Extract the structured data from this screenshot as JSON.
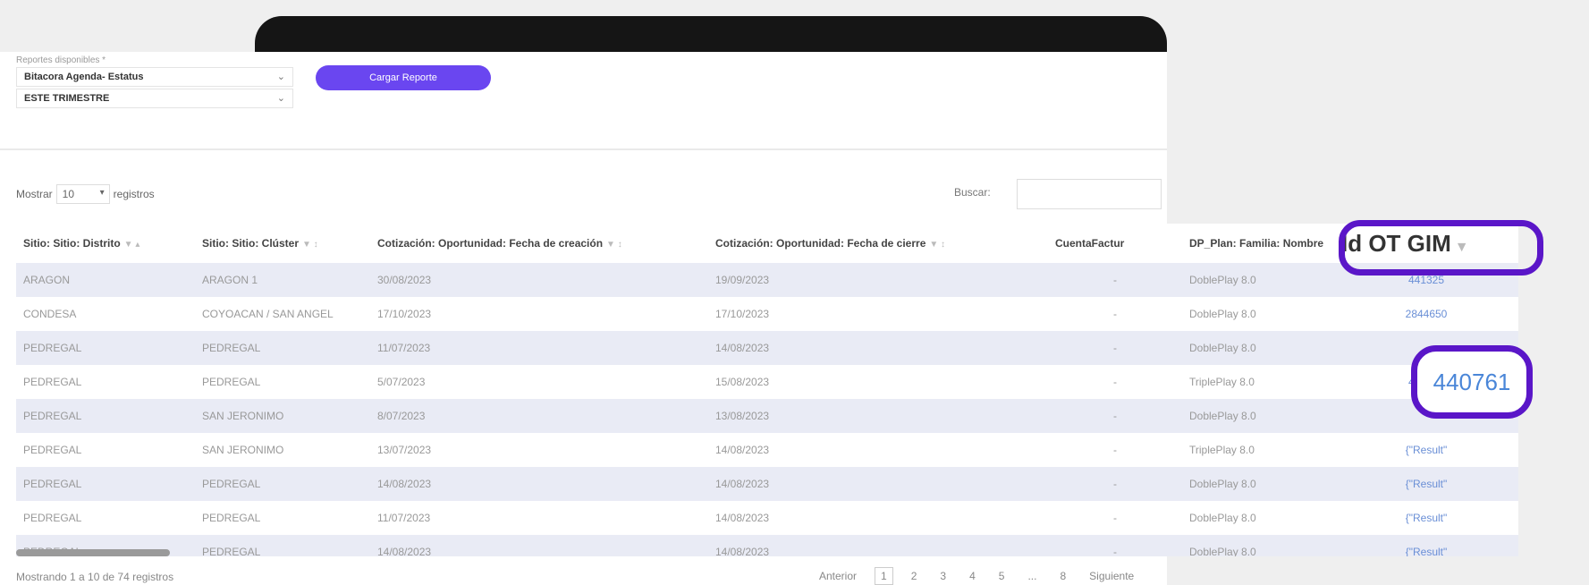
{
  "report": {
    "label": "Reportes disponibles *",
    "selected_report": "Bitacora Agenda- Estatus",
    "selected_period": "ESTE TRIMESTRE",
    "load_button": "Cargar Reporte"
  },
  "table_controls": {
    "show_label": "Mostrar",
    "page_size": "10",
    "records_label": "registros",
    "search_label": "Buscar:",
    "search_value": ""
  },
  "columns": [
    "Sitio: Sitio: Distrito",
    "Sitio: Sitio: Clúster",
    "Cotización: Oportunidad: Fecha de creación",
    "Cotización: Oportunidad: Fecha de cierre",
    "CuentaFactur",
    "DP_Plan: Familia: Nombre",
    "Id OT GIM"
  ],
  "rows": [
    [
      "ARAGON",
      "ARAGON 1",
      "30/08/2023",
      "19/09/2023",
      "-",
      "DoblePlay 8.0",
      "441325"
    ],
    [
      "CONDESA",
      "COYOACAN / SAN ANGEL",
      "17/10/2023",
      "17/10/2023",
      "-",
      "DoblePlay 8.0",
      "2844650"
    ],
    [
      "PEDREGAL",
      "PEDREGAL",
      "11/07/2023",
      "14/08/2023",
      "-",
      "DoblePlay 8.0",
      ""
    ],
    [
      "PEDREGAL",
      "PEDREGAL",
      "5/07/2023",
      "15/08/2023",
      "-",
      "TriplePlay 8.0",
      "440761"
    ],
    [
      "PEDREGAL",
      "SAN JERONIMO",
      "8/07/2023",
      "13/08/2023",
      "-",
      "DoblePlay 8.0",
      ""
    ],
    [
      "PEDREGAL",
      "SAN JERONIMO",
      "13/07/2023",
      "14/08/2023",
      "-",
      "TriplePlay 8.0",
      "{\"Result\""
    ],
    [
      "PEDREGAL",
      "PEDREGAL",
      "14/08/2023",
      "14/08/2023",
      "-",
      "DoblePlay 8.0",
      "{\"Result\""
    ],
    [
      "PEDREGAL",
      "PEDREGAL",
      "11/07/2023",
      "14/08/2023",
      "-",
      "DoblePlay 8.0",
      "{\"Result\""
    ],
    [
      "PEDREGAL",
      "PEDREGAL",
      "14/08/2023",
      "14/08/2023",
      "-",
      "DoblePlay 8.0",
      "{\"Result\""
    ]
  ],
  "highlight": {
    "header": "Id OT GIM",
    "value": "440761"
  },
  "footer": {
    "info": "Mostrando 1 a 10 de 74 registros",
    "prev": "Anterior",
    "pages": [
      "1",
      "2",
      "3",
      "4",
      "5",
      "...",
      "8"
    ],
    "next": "Siguiente"
  },
  "colors": {
    "accent": "#6a46f0",
    "highlight_ring": "#5a16c8",
    "link": "#6a8fd6",
    "row_alt": "#e9ebf5"
  }
}
